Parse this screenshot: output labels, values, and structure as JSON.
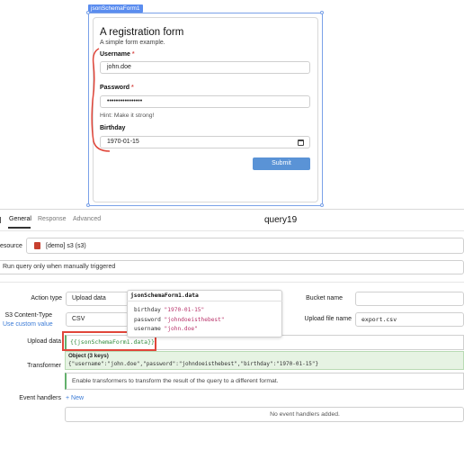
{
  "canvas": {
    "component_tag": "jsonSchemaForm1"
  },
  "form": {
    "title": "A registration form",
    "subtitle": "A simple form example.",
    "username_label": "Username",
    "username_required": "*",
    "username_value": "john.doe",
    "password_label": "Password",
    "password_required": "*",
    "password_value": "••••••••••••••••",
    "hint": "Hint: Make it strong!",
    "birthday_label": "Birthday",
    "birthday_value": "1970-01-15",
    "submit_label": "Submit"
  },
  "query": {
    "tabs": [
      {
        "label": "General",
        "active": true
      },
      {
        "label": "Response",
        "active": false
      },
      {
        "label": "Advanced",
        "active": false
      }
    ],
    "name": "query19",
    "resource_label": "esource",
    "resource_value": "[demo] s3 (s3)",
    "trigger_text": "Run query only when manually triggered",
    "action_type_label": "Action type",
    "action_type_value": "Upload data",
    "content_type_label": "S3 Content-Type",
    "use_custom_value": "Use custom value",
    "content_type_value": "CSV",
    "bucket_name_label": "Bucket name",
    "bucket_name_value": "",
    "upload_file_name_label": "Upload file name",
    "upload_file_name_value": "export.csv",
    "upload_data_label": "Upload data",
    "upload_data_value": "{{jsonSchemaForm1.data}}",
    "transformer_label": "Transformer",
    "object_title": "Object (3 keys)",
    "object_value": "{\"username\":\"john.doe\",\"password\":\"johndoeisthebest\",\"birthday\":\"1970-01-15\"}",
    "transformer_hint": "Enable transformers to transform the result of the query to a different format.",
    "event_handlers_label": "Event handlers",
    "new_label": "+ New",
    "no_handlers": "No event handlers added."
  },
  "popup": {
    "header": "jsonSchemaForm1.data",
    "rows": [
      {
        "key": "birthday",
        "value": "\"1970-01-15\""
      },
      {
        "key": "password",
        "value": "\"johndoeisthebest\""
      },
      {
        "key": "username",
        "value": "\"john.doe\""
      }
    ]
  },
  "colors": {
    "accent": "#5a93d6",
    "selection": "#7aa1e8",
    "annotation_red": "#e0463a",
    "success_green": "#62b06c"
  }
}
